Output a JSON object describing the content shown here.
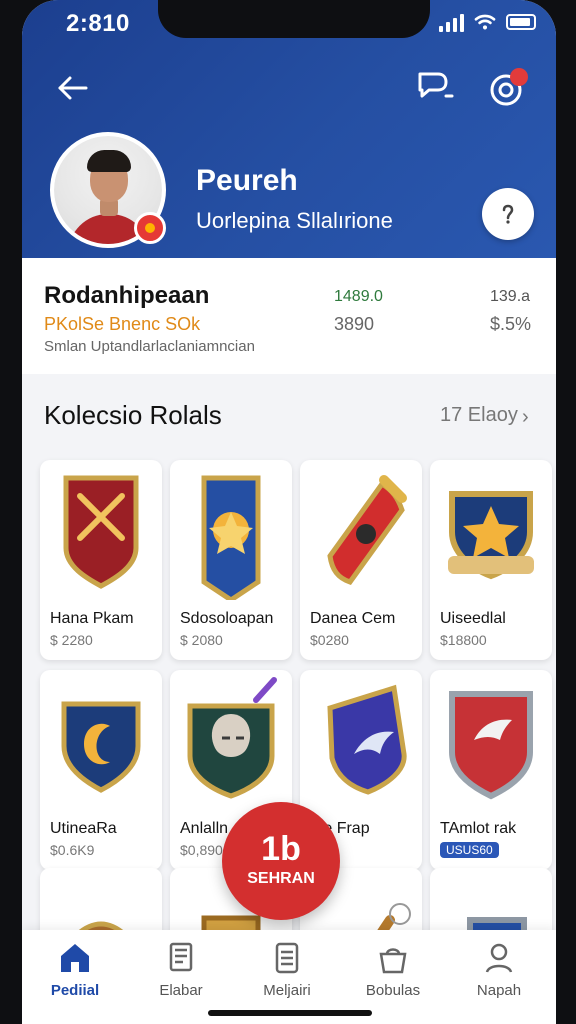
{
  "status": {
    "time": "2:810"
  },
  "header": {
    "name": "Peureh",
    "subtitle": "Uorlepina Sllalırione"
  },
  "summary": {
    "title": "Rodanhipeaan",
    "sub": "PKolSe Bnenc SOk",
    "desc": "Smlan Uptandlarlaclaniamncian",
    "values": [
      "1489.0",
      "3890",
      "139.a",
      "$.5%"
    ]
  },
  "collection": {
    "title": "Kolecsio Rolals",
    "link": "17 Elaoy"
  },
  "cards": [
    {
      "name": "Hana Pkam",
      "price": "$ 2280"
    },
    {
      "name": "Sdosoloapan",
      "price": "$ 2080"
    },
    {
      "name": "Danea Cem",
      "price": "$0280"
    },
    {
      "name": "Uiseedlal",
      "price": "$18800"
    },
    {
      "name": "UtineaRa",
      "price": "$0.6K9"
    },
    {
      "name": "Anlalln",
      "price": "$0,890"
    },
    {
      "name": "Ihe Frap",
      "price": ""
    },
    {
      "name": "TAmlot rak",
      "price": "USUS60"
    }
  ],
  "fab": {
    "icon": "1b",
    "label": "SEHRAN"
  },
  "nav": [
    {
      "label": "Pediial"
    },
    {
      "label": "Elabar"
    },
    {
      "label": "Meljairi"
    },
    {
      "label": "Bobulas"
    },
    {
      "label": "Napah"
    }
  ],
  "colors": {
    "brand": "#254fa3",
    "accent": "#d32f2f",
    "nav_active": "#1f4aa8"
  }
}
